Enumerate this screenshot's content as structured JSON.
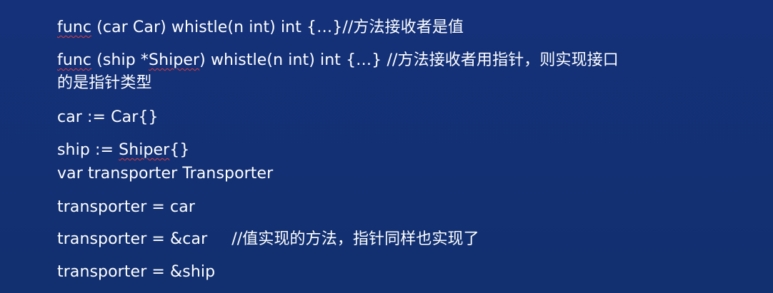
{
  "lines": {
    "l1": {
      "kw": "func",
      "rest": " (car Car) whistle(n int) int {…}//方法接收者是值"
    },
    "l2": {
      "kw": "func",
      "mid1": " (ship *",
      "type": "Shiper",
      "mid2": ") whistle(n int) int {…} //方法接收者用指针，则实现接口"
    },
    "l3": {
      "text": "的是指针类型"
    },
    "l4": {
      "text": "car := Car{}"
    },
    "l5": {
      "pre": "ship := ",
      "type": "Shiper",
      "post": "{}"
    },
    "l6": {
      "text": "var transporter Transporter"
    },
    "l7": {
      "text": "transporter = car"
    },
    "l8": {
      "code": "transporter = &car",
      "comment": "//值实现的方法，指针同样也实现了"
    },
    "l9": {
      "text": "transporter = &ship"
    }
  }
}
